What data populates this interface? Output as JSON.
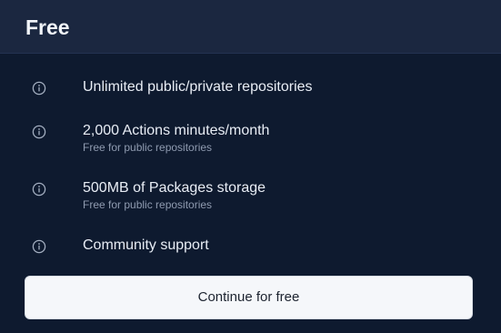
{
  "plan": {
    "title": "Free"
  },
  "features": [
    {
      "icon": "info-icon",
      "title": "Unlimited public/private repositories",
      "subtitle": ""
    },
    {
      "icon": "info-icon",
      "title": "2,000 Actions minutes/month",
      "subtitle": "Free for public repositories"
    },
    {
      "icon": "info-icon",
      "title": "500MB of Packages storage",
      "subtitle": "Free for public repositories"
    },
    {
      "icon": "info-icon",
      "title": "Community support",
      "subtitle": ""
    }
  ],
  "cta": {
    "label": "Continue for free"
  },
  "colors": {
    "background": "#0e1a2f",
    "header": "#1b2740",
    "button": "#f5f7fa"
  }
}
